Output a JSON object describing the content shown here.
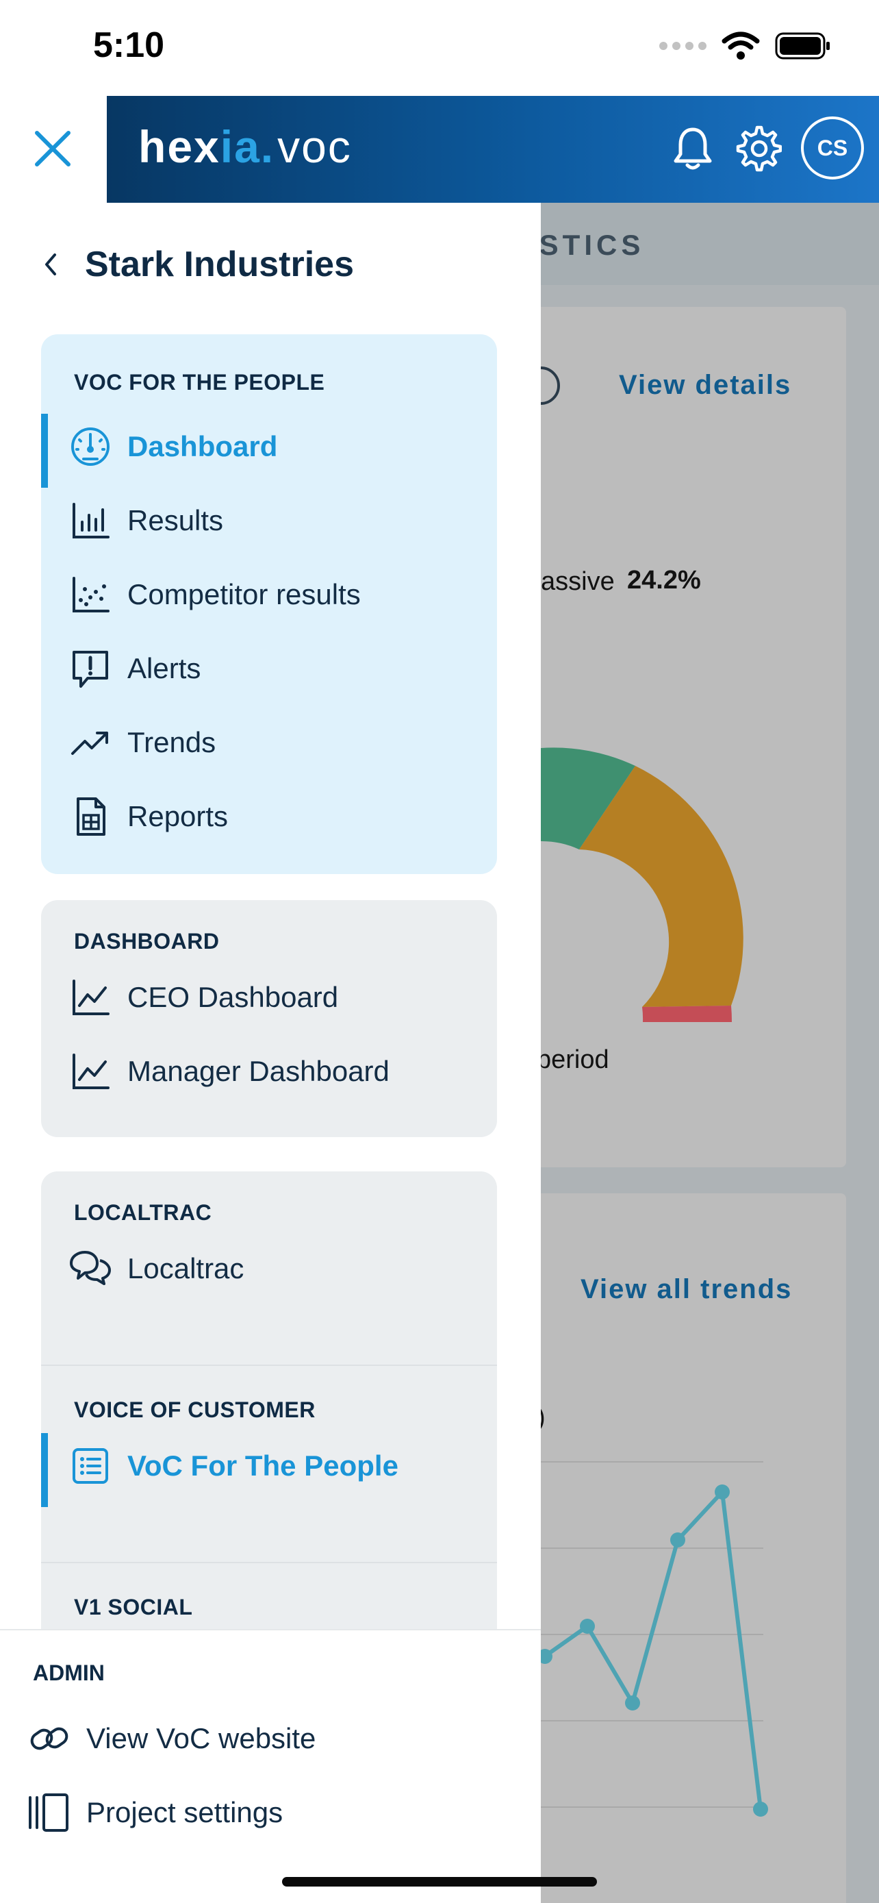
{
  "status_bar": {
    "time": "5:10"
  },
  "header": {
    "logo": {
      "part1": "hex",
      "part2": "ia",
      "part3": ".",
      "part4": "voc"
    },
    "avatar_initials": "CS"
  },
  "background": {
    "section_title": "ISTICS",
    "view_details": "View details",
    "passive_label": "assive",
    "passive_value": "24.2%",
    "period_label": "period",
    "view_all_trends": "View all trends",
    "chart_partial_label": ")"
  },
  "drawer": {
    "title": "Stark Industries",
    "groups": [
      {
        "label": "VOC FOR THE PEOPLE",
        "items": [
          {
            "label": "Dashboard",
            "icon": "gauge-icon",
            "selected": true
          },
          {
            "label": "Results",
            "icon": "bar-chart-icon"
          },
          {
            "label": "Competitor results",
            "icon": "scatter-chart-icon"
          },
          {
            "label": "Alerts",
            "icon": "alert-message-icon"
          },
          {
            "label": "Trends",
            "icon": "trend-up-icon"
          },
          {
            "label": "Reports",
            "icon": "report-document-icon"
          }
        ]
      },
      {
        "label": "DASHBOARD",
        "items": [
          {
            "label": "CEO Dashboard",
            "icon": "line-chart-icon"
          },
          {
            "label": "Manager Dashboard",
            "icon": "line-chart-icon"
          }
        ]
      },
      {
        "label": "LOCALTRAC",
        "items": [
          {
            "label": "Localtrac",
            "icon": "chat-bubbles-icon"
          }
        ]
      },
      {
        "label": "VOICE OF CUSTOMER",
        "items": [
          {
            "label": "VoC For The People",
            "icon": "list-icon",
            "selected": true
          }
        ]
      },
      {
        "label": "V1 SOCIAL",
        "items": []
      }
    ],
    "admin": {
      "label": "ADMIN",
      "items": [
        {
          "label": "View VoC website",
          "icon": "link-icon"
        },
        {
          "label": "Project settings",
          "icon": "settings-panel-icon"
        }
      ]
    }
  },
  "colors": {
    "accent": "#1994d7",
    "header_dark": "#073763",
    "header_light": "#1c75c8",
    "gauge_green": "#3f9070",
    "gauge_orange": "#b57f23",
    "gauge_red": "#c44d56",
    "trend_line": "#4ea3b3"
  }
}
